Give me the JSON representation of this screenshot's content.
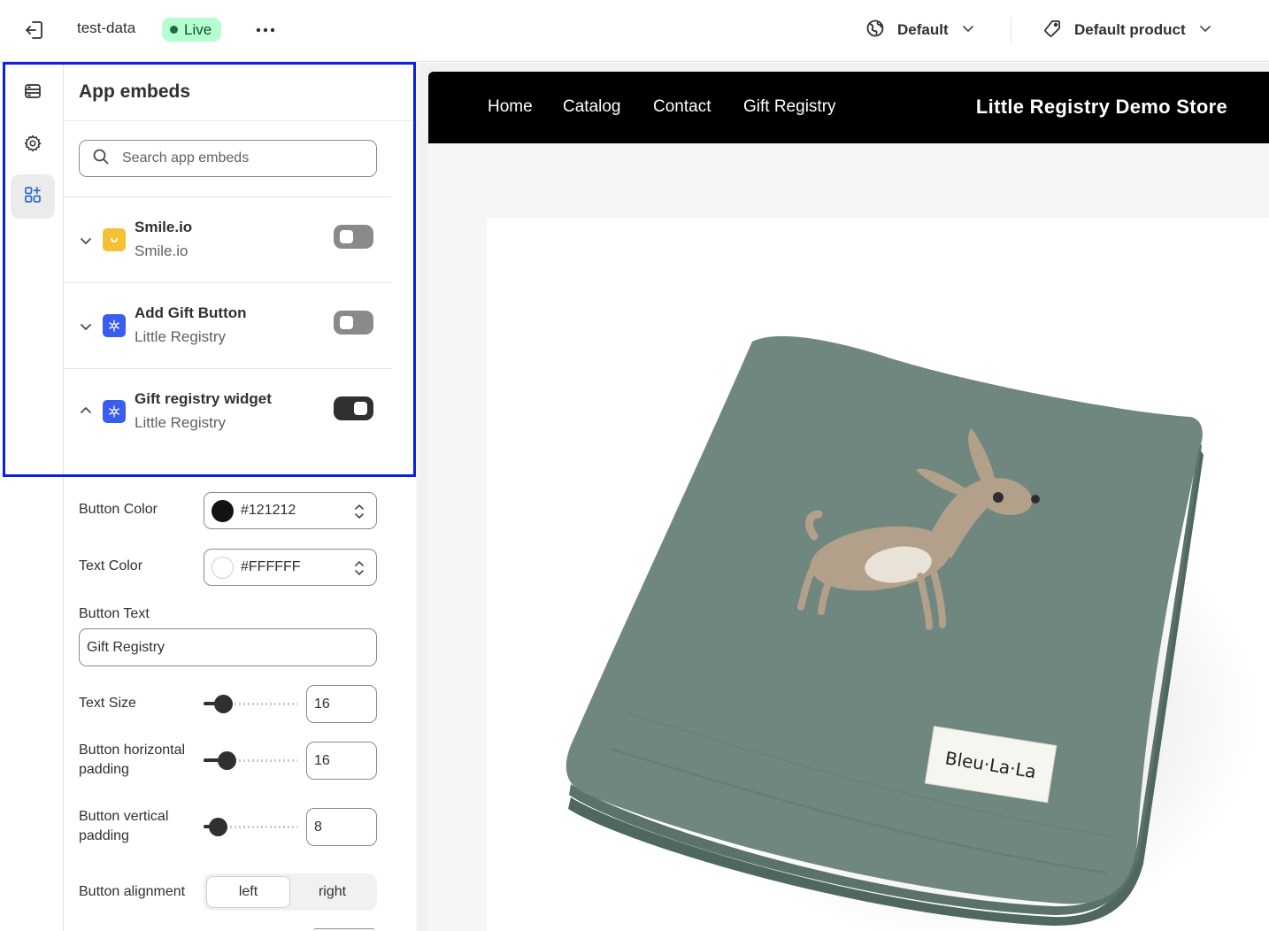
{
  "topbar": {
    "store_name": "test-data",
    "status_badge": "Live",
    "theme_label": "Default",
    "template_label": "Default product"
  },
  "sidebar": {
    "title": "App embeds",
    "search_placeholder": "Search app embeds",
    "embeds": [
      {
        "name": "Smile.io",
        "app": "Smile.io",
        "enabled": false,
        "expanded": false,
        "icon": "smile-icon",
        "icon_color": "#f5c035"
      },
      {
        "name": "Add Gift Button",
        "app": "Little Registry",
        "enabled": false,
        "expanded": false,
        "icon": "snowflake-icon",
        "icon_color": "#3a5df0"
      },
      {
        "name": "Gift registry widget",
        "app": "Little Registry",
        "enabled": true,
        "expanded": true,
        "icon": "snowflake-icon",
        "icon_color": "#3a5df0"
      }
    ],
    "settings": {
      "button_color_label": "Button Color",
      "button_color_value": "#121212",
      "text_color_label": "Text Color",
      "text_color_value": "#FFFFFF",
      "button_text_label": "Button Text",
      "button_text_value": "Gift Registry",
      "text_size_label": "Text Size",
      "text_size_value": "16",
      "h_padding_label": "Button horizontal padding",
      "h_padding_value": "16",
      "v_padding_label": "Button vertical padding",
      "v_padding_value": "8",
      "alignment_label": "Button alignment",
      "alignment_options": [
        "left",
        "right"
      ],
      "alignment_selected": "left"
    }
  },
  "preview": {
    "nav_links": [
      "Home",
      "Catalog",
      "Contact",
      "Gift Registry"
    ],
    "store_title": "Little Registry Demo Store",
    "product_image_label": "Bleu·La·La"
  },
  "colors": {
    "highlight_border": "#0a22e0",
    "live_badge_bg": "#b4fed2",
    "toggle_off": "#8a8a8a",
    "toggle_on": "#303030"
  }
}
